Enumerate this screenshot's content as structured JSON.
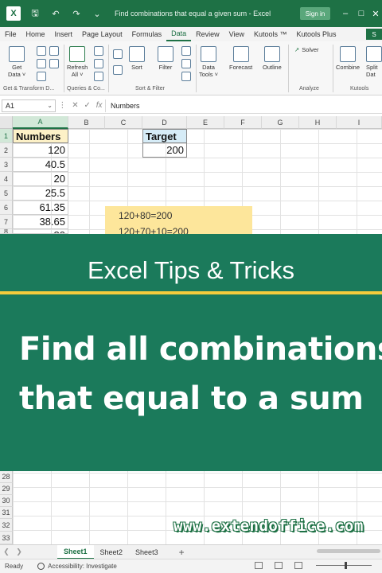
{
  "titlebar": {
    "title": "Find combinations that equal a given sum - Excel",
    "signin": "Sign in",
    "app_letter": "X",
    "colors": {
      "excel_green": "#1e7145"
    }
  },
  "menu": {
    "tabs": [
      "File",
      "Home",
      "Insert",
      "Page Layout",
      "Formulas",
      "Data",
      "Review",
      "View",
      "Kutools ™",
      "Kutools Plus"
    ],
    "active": "Data",
    "share": "S"
  },
  "ribbon": {
    "get_data": "Get",
    "get_data2": "Data ˅",
    "refresh": "Refresh",
    "refresh2": "All ˅",
    "sort": "Sort",
    "filter": "Filter",
    "data_tools": "Data",
    "data_tools2": "Tools ˅",
    "forecast": "Forecast",
    "outline": "Outline",
    "solver": "Solver",
    "combine": "Combine",
    "split": "Split",
    "split2": "Dat",
    "groups": {
      "get_transform": "Get & Transform D...",
      "queries": "Queries & Co...",
      "sort_filter": "Sort & Filter",
      "analyze": "Analyze",
      "kutools": "Kutools"
    }
  },
  "formula_bar": {
    "name_box": "A1",
    "content": "Numbers",
    "fx": "fx"
  },
  "grid": {
    "columns": [
      "A",
      "B",
      "C",
      "D",
      "E",
      "F",
      "G",
      "H",
      "I"
    ],
    "rows_top": [
      "1",
      "2",
      "3",
      "4",
      "5",
      "6",
      "7",
      "8"
    ],
    "rows_bottom": [
      "28",
      "29",
      "30",
      "31",
      "32",
      "33"
    ],
    "header_a": "Numbers",
    "values_a": [
      "120",
      "40.5",
      "20",
      "25.5",
      "61.35",
      "38.65",
      "80"
    ],
    "header_d": "Target",
    "value_d": "200",
    "results": [
      "120+80=200",
      "120+70+10=200"
    ]
  },
  "banner": {
    "tips": "Excel Tips & Tricks",
    "headline_line1": "Find all combinations",
    "headline_line2": "that equal to a sum",
    "colors": {
      "background": "#1b7a5b",
      "accent": "#f5cc3c"
    }
  },
  "watermark": "www.extendoffice.com",
  "sheets": {
    "tabs": [
      "Sheet1",
      "Sheet2",
      "Sheet3"
    ],
    "active": "Sheet1",
    "add": "+"
  },
  "status": {
    "ready": "Ready",
    "accessibility": "Accessibility: Investigate"
  }
}
